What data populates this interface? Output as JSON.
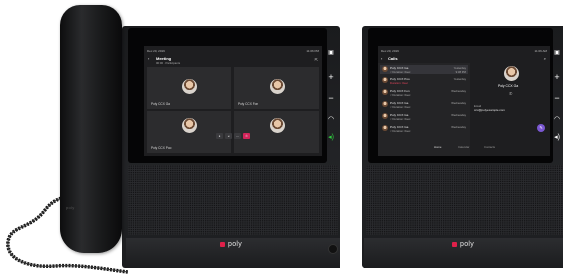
{
  "brand": "poly",
  "handset_brand": "poly",
  "phone1": {
    "status_date": "Dec 20, 2019",
    "status_time": "11:06 PM",
    "meeting_title": "Meeting",
    "meeting_sub": "00:00 · Participants",
    "tiles": [
      {
        "name": "Poly CCX Ga"
      },
      {
        "name": "Poly CCX Fon"
      },
      {
        "name": "Poly CCX Poo"
      },
      {
        "name": ""
      }
    ],
    "controls": [
      "mic",
      "video",
      "more",
      "end"
    ]
  },
  "phone2": {
    "status_date": "Dec 20, 2019",
    "status_time": "11:06 AM",
    "header": "Calls",
    "search_hint": "Search",
    "list": [
      {
        "name": "Poly CCX Ga",
        "sub": "< Duration: 0sec",
        "time": "Yesterday",
        "time2": "9:38 PM"
      },
      {
        "name": "Poly CCX Poo",
        "sub": "Duration: 0sec",
        "time": "Yesterday",
        "time2": ""
      },
      {
        "name": "Poly CCX Fon",
        "sub": "< Duration: 0sec",
        "time": "Wednesday",
        "time2": ""
      },
      {
        "name": "Poly CCX Ga",
        "sub": "< Duration: 0sec",
        "time": "Wednesday",
        "time2": ""
      },
      {
        "name": "Poly CCX Ga",
        "sub": "< Duration: 0sec",
        "time": "Wednesday",
        "time2": ""
      },
      {
        "name": "Poly CCX Ga",
        "sub": "< Duration: 0sec",
        "time": "Wednesday",
        "time2": ""
      }
    ],
    "detail_name": "Poly CCX Ga",
    "detail_email_label": "Email",
    "detail_email": "ccx@polyexample.com",
    "bottom_tabs": [
      "Home",
      "Calendar",
      "Contacts"
    ]
  },
  "colors": {
    "end_call": "#d2245a",
    "headset_key": "#2fce3f",
    "brand_dot": "#e0204a",
    "accent_purple": "#7a57d1"
  }
}
